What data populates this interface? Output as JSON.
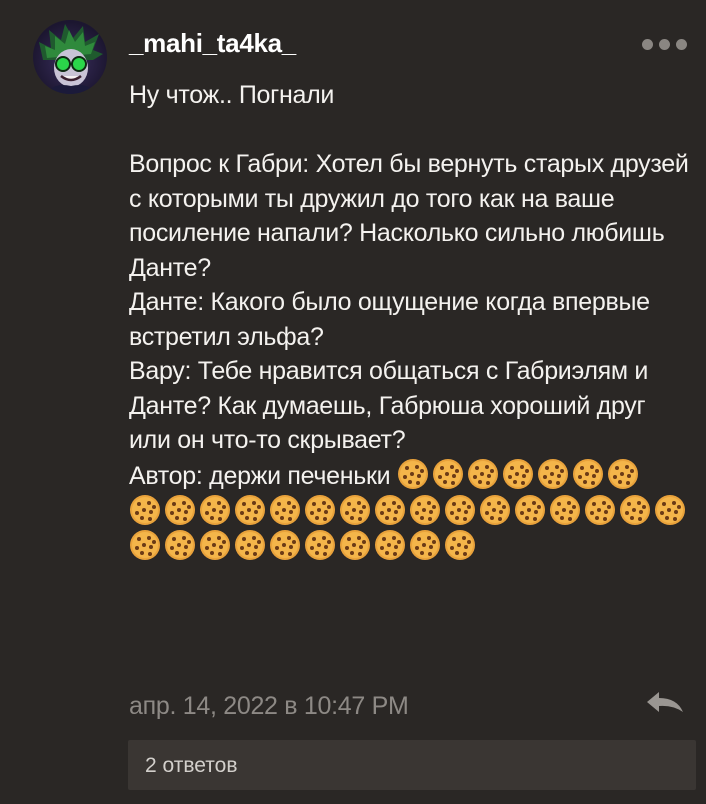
{
  "comment": {
    "username": "_mahi_ta4ka_",
    "text": {
      "line1": "Ну чтож.. Погнали",
      "q_gabri": "Вопрос к Габри: Хотел бы вернуть старых друзей с которыми ты дружил до того как на ваше посиление напали? Насколько сильно любишь Данте?",
      "q_dante": "Данте: Какого было ощущение когда впервые встретил эльфа?",
      "q_varu": "Вару: Тебе нравится общаться с Габриэлям и Данте? Как думаешь, Габрюша хороший друг или он что-то скрывает?",
      "author": "Автор: держи печеньки"
    },
    "cookie_emoji_count": 33,
    "timestamp": "апр. 14, 2022 в 10:47 PM",
    "replies_label": "2 ответов",
    "icons": {
      "menu": "more-horizontal-icon",
      "reply": "reply-arrow-icon",
      "cookie": "cookie-emoji"
    },
    "colors": {
      "background": "#2a2725",
      "text": "#f4f2ef",
      "muted": "#8d8985",
      "replies_bg": "#3a3633"
    }
  }
}
